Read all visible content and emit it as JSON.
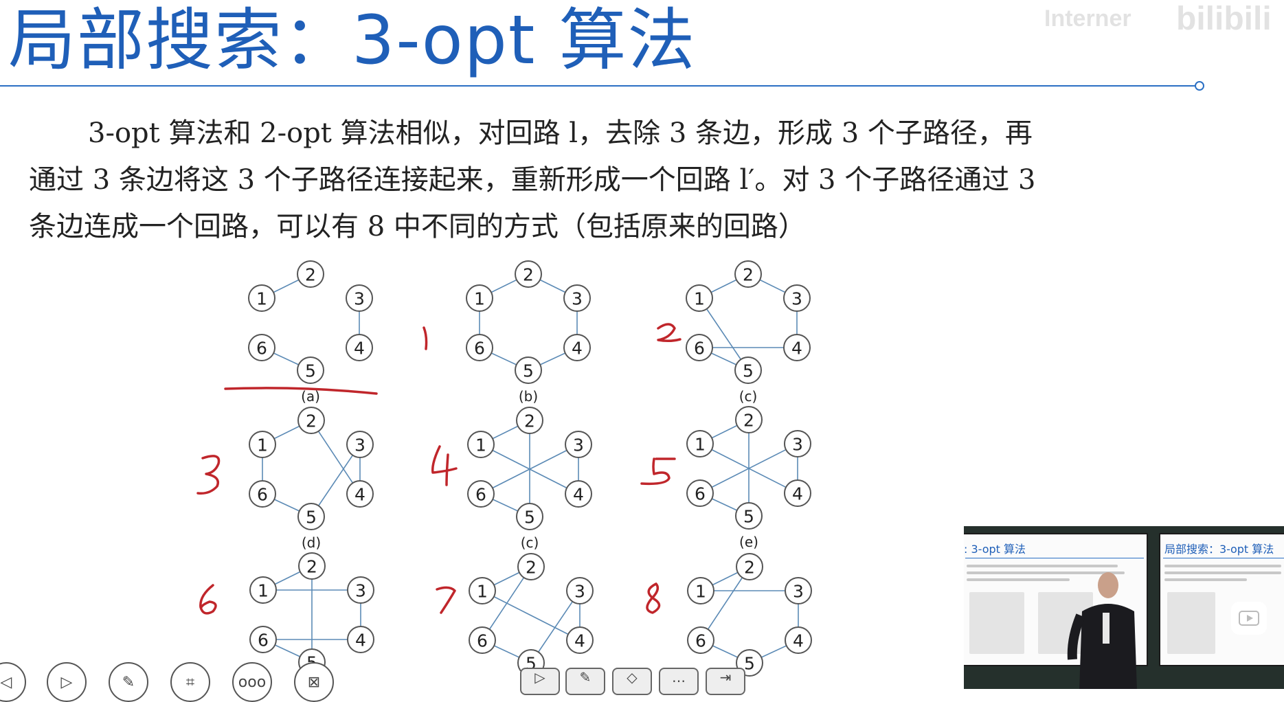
{
  "slide": {
    "title": "局部搜索：3-opt 算法",
    "paragraph": [
      "3-opt 算法和 2-opt 算法相似，对回路 l，去除 3 条边，形成 3 个子路径，再",
      "通过 3 条边将这 3 个子路径连接起来，重新形成一个回路 l′。对 3 个子路径通过 3",
      "条边连成一个回路，可以有 8 中不同的方式（包括原来的回路）"
    ]
  },
  "watermark": {
    "text": "Interner",
    "brand": "bilibili"
  },
  "diagrams": [
    {
      "caption": "(a)",
      "nodes": [
        "1",
        "2",
        "3",
        "4",
        "5",
        "6"
      ]
    },
    {
      "caption": "(b)",
      "nodes": [
        "1",
        "2",
        "3",
        "4",
        "5",
        "6"
      ]
    },
    {
      "caption": "(c)",
      "nodes": [
        "1",
        "2",
        "3",
        "4",
        "5",
        "6"
      ]
    },
    {
      "caption": "(d)",
      "nodes": [
        "1",
        "2",
        "3",
        "4",
        "5",
        "6"
      ]
    },
    {
      "caption": "(c)",
      "nodes": [
        "1",
        "2",
        "3",
        "4",
        "5",
        "6"
      ]
    },
    {
      "caption": "(e)",
      "nodes": [
        "1",
        "2",
        "3",
        "4",
        "5",
        "6"
      ]
    },
    {
      "caption": "",
      "nodes": [
        "1",
        "2",
        "3",
        "4",
        "5",
        "6"
      ]
    },
    {
      "caption": "",
      "nodes": [
        "1",
        "2",
        "3",
        "4",
        "5",
        "6"
      ]
    },
    {
      "caption": "",
      "nodes": [
        "1",
        "2",
        "3",
        "4",
        "5",
        "6"
      ]
    }
  ],
  "annotations": {
    "ink_color": "#c0262b",
    "numbers": [
      "1",
      "2",
      "3",
      "4",
      "5",
      "6",
      "7",
      "8"
    ]
  },
  "toolbar": {
    "more_label": "ooo",
    "buttons": [
      "previous-icon",
      "next-icon",
      "pen-icon",
      "crop-icon",
      "more-icon",
      "close-window-icon"
    ]
  },
  "inset_video": {
    "left_slide_title": ": 3-opt 算法",
    "right_slide_title": "局部搜索：3-opt 算法"
  },
  "colors": {
    "title_blue": "#1f5fb8",
    "edge_blue": "#5b8ab5"
  }
}
